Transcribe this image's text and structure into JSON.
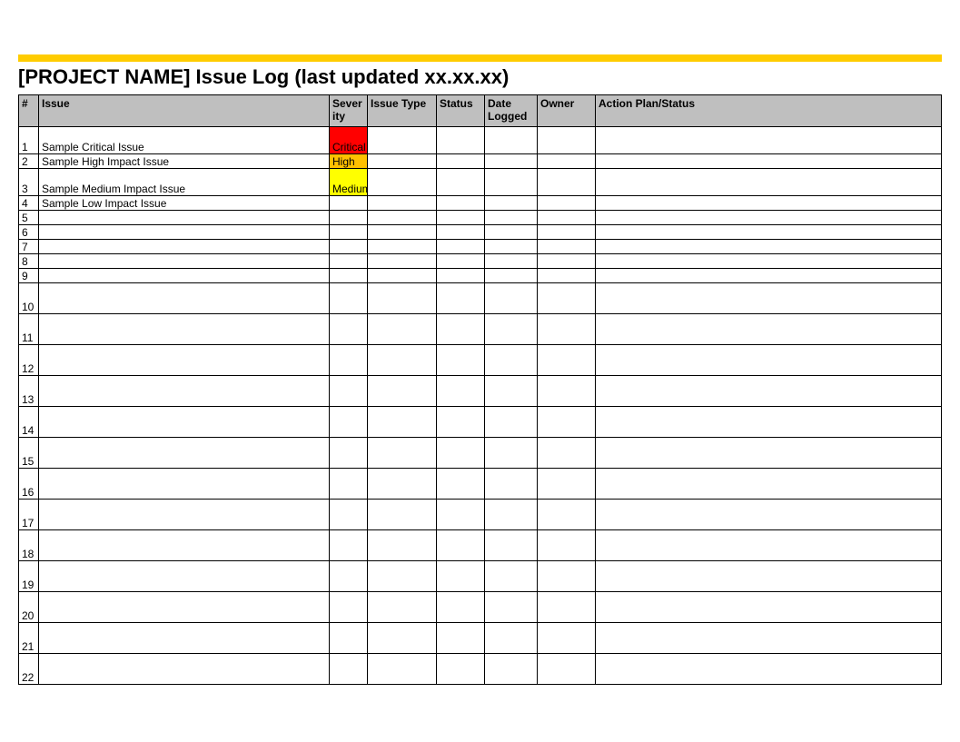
{
  "accent_color": "#ffcc00",
  "title": "[PROJECT NAME] Issue Log (last updated xx.xx.xx)",
  "columns": {
    "num": "#",
    "issue": "Issue",
    "severity": "Severity",
    "issue_type": "Issue Type",
    "status": "Status",
    "date_logged": "Date Logged",
    "owner": "Owner",
    "action_plan": "Action Plan/Status"
  },
  "severity_colors": {
    "Critical": "#ff0000",
    "High": "#ffc000",
    "Medium": "#ffff00"
  },
  "rows": [
    {
      "num": "1",
      "issue": "Sample Critical Issue",
      "severity": "Critical",
      "issue_type": "",
      "status": "",
      "date_logged": "",
      "owner": "",
      "action_plan": "",
      "size": "med"
    },
    {
      "num": "2",
      "issue": "Sample High Impact Issue",
      "severity": "High",
      "issue_type": "",
      "status": "",
      "date_logged": "",
      "owner": "",
      "action_plan": "",
      "size": "small"
    },
    {
      "num": "3",
      "issue": "Sample Medium Impact Issue",
      "severity": "Medium",
      "issue_type": "",
      "status": "",
      "date_logged": "",
      "owner": "",
      "action_plan": "",
      "size": "med"
    },
    {
      "num": "4",
      "issue": "Sample Low Impact Issue",
      "severity": "",
      "issue_type": "",
      "status": "",
      "date_logged": "",
      "owner": "",
      "action_plan": "",
      "size": "small",
      "dropdown": true
    },
    {
      "num": "5",
      "issue": "",
      "severity": "",
      "issue_type": "",
      "status": "",
      "date_logged": "",
      "owner": "",
      "action_plan": "",
      "size": "small"
    },
    {
      "num": "6",
      "issue": "",
      "severity": "",
      "issue_type": "",
      "status": "",
      "date_logged": "",
      "owner": "",
      "action_plan": "",
      "size": "small"
    },
    {
      "num": "7",
      "issue": "",
      "severity": "",
      "issue_type": "",
      "status": "",
      "date_logged": "",
      "owner": "",
      "action_plan": "",
      "size": "small"
    },
    {
      "num": "8",
      "issue": "",
      "severity": "",
      "issue_type": "",
      "status": "",
      "date_logged": "",
      "owner": "",
      "action_plan": "",
      "size": "small"
    },
    {
      "num": "9",
      "issue": "",
      "severity": "",
      "issue_type": "",
      "status": "",
      "date_logged": "",
      "owner": "",
      "action_plan": "",
      "size": "small"
    },
    {
      "num": "10",
      "issue": "",
      "severity": "",
      "issue_type": "",
      "status": "",
      "date_logged": "",
      "owner": "",
      "action_plan": "",
      "size": "big"
    },
    {
      "num": "11",
      "issue": "",
      "severity": "",
      "issue_type": "",
      "status": "",
      "date_logged": "",
      "owner": "",
      "action_plan": "",
      "size": "big"
    },
    {
      "num": "12",
      "issue": "",
      "severity": "",
      "issue_type": "",
      "status": "",
      "date_logged": "",
      "owner": "",
      "action_plan": "",
      "size": "big"
    },
    {
      "num": "13",
      "issue": "",
      "severity": "",
      "issue_type": "",
      "status": "",
      "date_logged": "",
      "owner": "",
      "action_plan": "",
      "size": "big"
    },
    {
      "num": "14",
      "issue": "",
      "severity": "",
      "issue_type": "",
      "status": "",
      "date_logged": "",
      "owner": "",
      "action_plan": "",
      "size": "big"
    },
    {
      "num": "15",
      "issue": "",
      "severity": "",
      "issue_type": "",
      "status": "",
      "date_logged": "",
      "owner": "",
      "action_plan": "",
      "size": "big"
    },
    {
      "num": "16",
      "issue": "",
      "severity": "",
      "issue_type": "",
      "status": "",
      "date_logged": "",
      "owner": "",
      "action_plan": "",
      "size": "big"
    },
    {
      "num": "17",
      "issue": "",
      "severity": "",
      "issue_type": "",
      "status": "",
      "date_logged": "",
      "owner": "",
      "action_plan": "",
      "size": "big"
    },
    {
      "num": "18",
      "issue": "",
      "severity": "",
      "issue_type": "",
      "status": "",
      "date_logged": "",
      "owner": "",
      "action_plan": "",
      "size": "big"
    },
    {
      "num": "19",
      "issue": "",
      "severity": "",
      "issue_type": "",
      "status": "",
      "date_logged": "",
      "owner": "",
      "action_plan": "",
      "size": "big"
    },
    {
      "num": "20",
      "issue": "",
      "severity": "",
      "issue_type": "",
      "status": "",
      "date_logged": "",
      "owner": "",
      "action_plan": "",
      "size": "big"
    },
    {
      "num": "21",
      "issue": "",
      "severity": "",
      "issue_type": "",
      "status": "",
      "date_logged": "",
      "owner": "",
      "action_plan": "",
      "size": "big"
    },
    {
      "num": "22",
      "issue": "",
      "severity": "",
      "issue_type": "",
      "status": "",
      "date_logged": "",
      "owner": "",
      "action_plan": "",
      "size": "big"
    }
  ]
}
